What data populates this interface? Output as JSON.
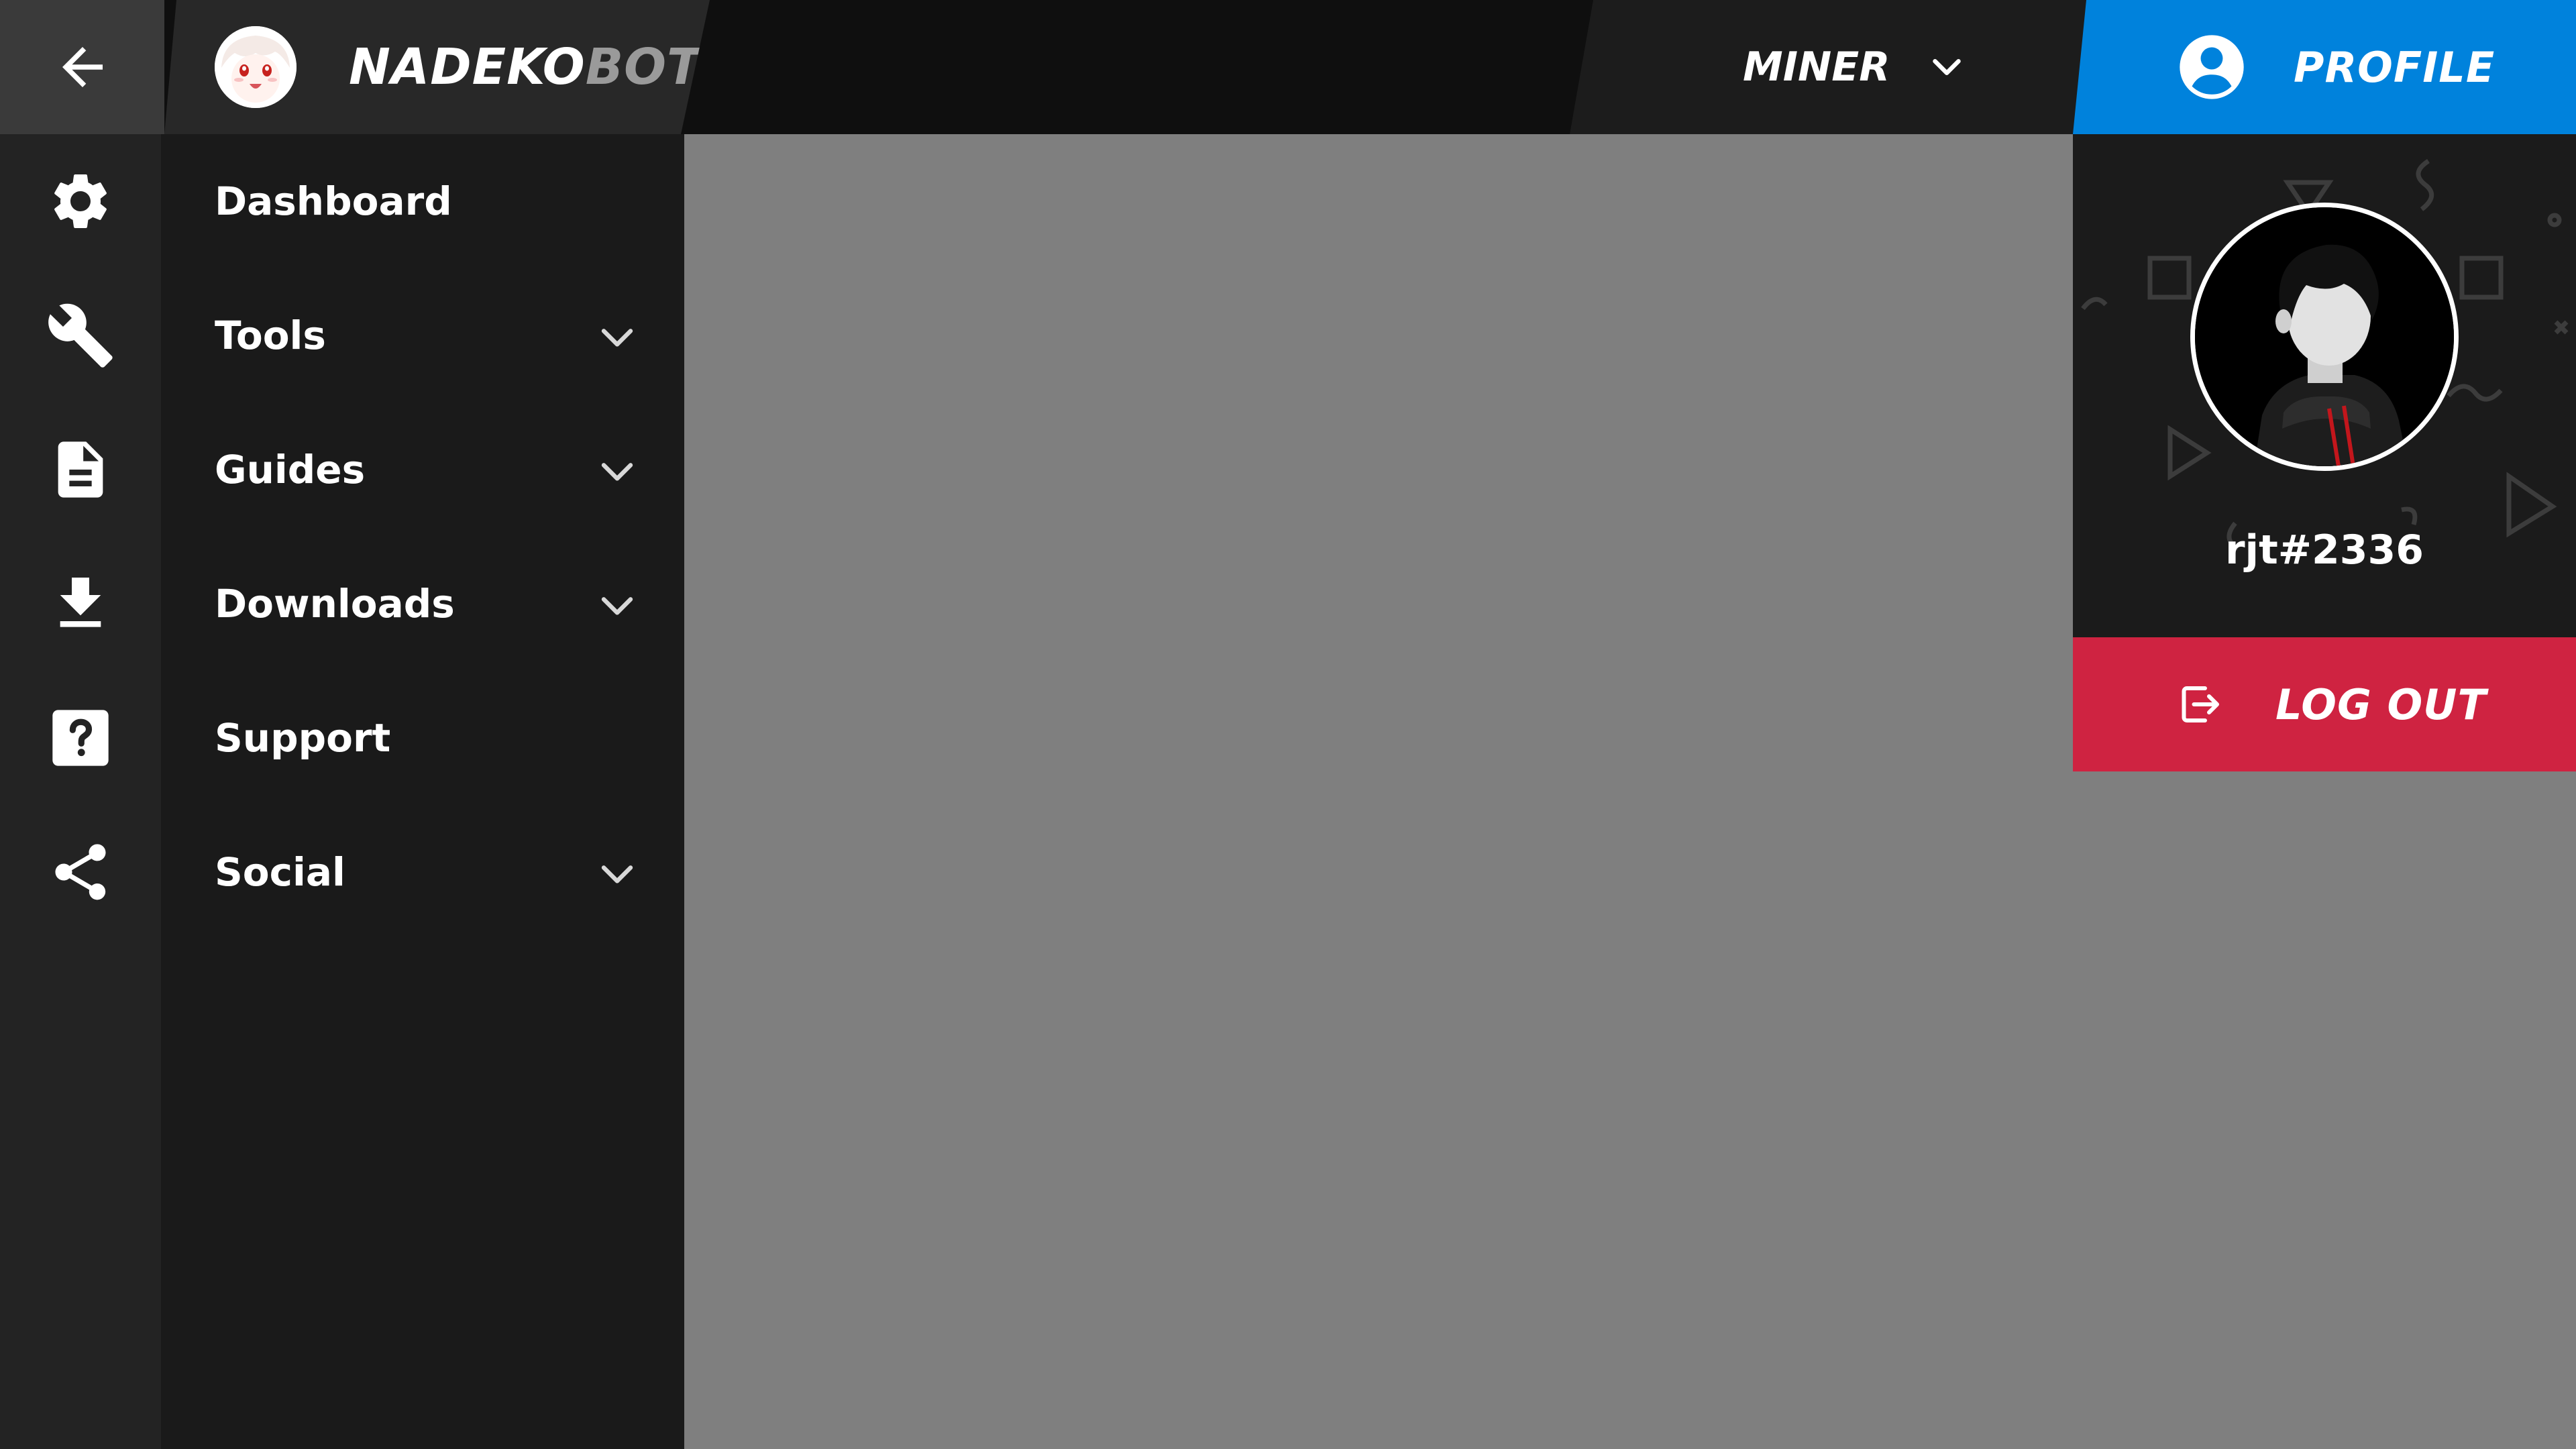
{
  "colors": {
    "top_bar": "#0f0f0f",
    "icon_rail": "#232323",
    "menu": "#1a1a1a",
    "content": "#7f7f7f",
    "profile_accent": "#0082dc",
    "logout_accent": "#cf2341"
  },
  "header": {
    "back_icon": "arrow-left-icon",
    "brand": {
      "name_primary": "NADEKO",
      "name_secondary": "BOT",
      "logo_icon": "nadeko-logo"
    },
    "server_selector": {
      "value": "MINER",
      "icon": "chevron-down-icon"
    },
    "profile": {
      "label": "PROFILE",
      "icon": "account-circle-icon"
    }
  },
  "sidebar": {
    "items": [
      {
        "label": "Dashboard",
        "icon": "gear-icon",
        "expandable": false
      },
      {
        "label": "Tools",
        "icon": "wrench-icon",
        "expandable": true
      },
      {
        "label": "Guides",
        "icon": "document-icon",
        "expandable": true
      },
      {
        "label": "Downloads",
        "icon": "download-icon",
        "expandable": true
      },
      {
        "label": "Support",
        "icon": "help-icon",
        "expandable": false
      },
      {
        "label": "Social",
        "icon": "share-icon",
        "expandable": true
      }
    ]
  },
  "profile_menu": {
    "username": "rjt#2336",
    "avatar_icon": "user-avatar",
    "logout": {
      "label": "LOG OUT",
      "icon": "logout-icon"
    }
  }
}
